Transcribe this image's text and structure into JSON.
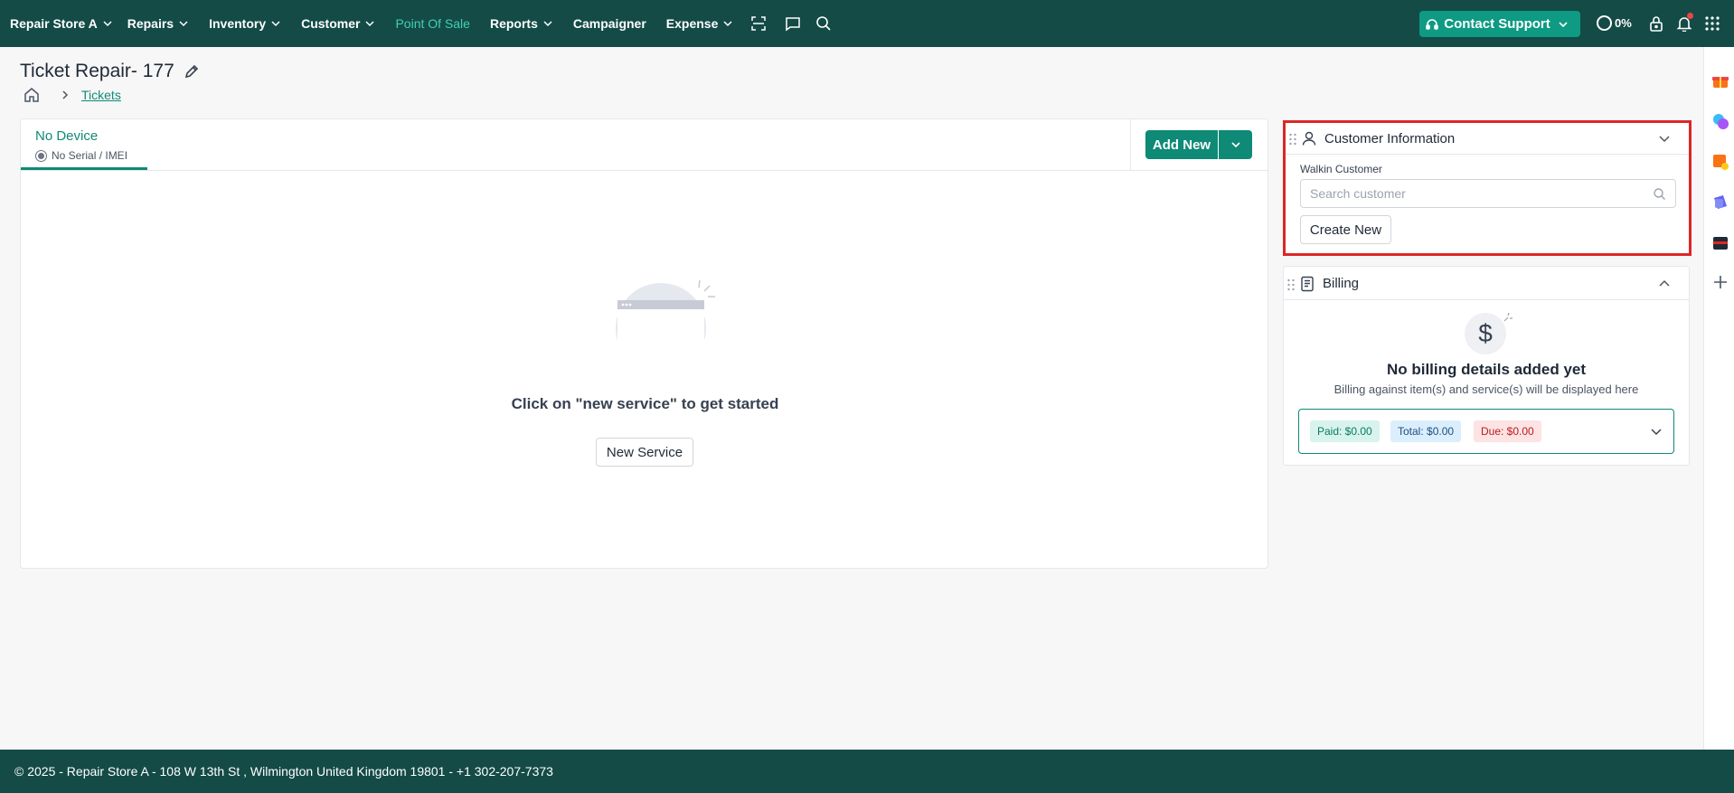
{
  "nav": {
    "store": "Repair Store A",
    "items": [
      {
        "label": "Repairs"
      },
      {
        "label": "Inventory"
      },
      {
        "label": "Customer"
      },
      {
        "label": "Point Of Sale"
      },
      {
        "label": "Reports"
      },
      {
        "label": "Campaigner"
      },
      {
        "label": "Expense"
      }
    ],
    "contact_support": "Contact Support",
    "progress": "0%"
  },
  "page": {
    "title": "Ticket Repair- 177",
    "breadcrumb": "Tickets"
  },
  "device": {
    "title": "No Device",
    "serial": "No Serial / IMEI",
    "add_new": "Add New"
  },
  "empty": {
    "title": "Click on \"new service\" to get started",
    "button": "New Service"
  },
  "customer": {
    "title": "Customer Information",
    "walkin": "Walkin Customer",
    "search_placeholder": "Search customer",
    "create_new": "Create New"
  },
  "billing": {
    "title": "Billing",
    "currency_symbol": "$",
    "empty_title": "No billing details added yet",
    "empty_sub": "Billing against item(s) and service(s) will be displayed here",
    "paid": "Paid: $0.00",
    "total": "Total: $0.00",
    "due": "Due: $0.00"
  },
  "footer": {
    "text": "© 2025 - Repair Store A - 108 W 13th St , Wilmington United Kingdom 19801 - +1 302-207-7373"
  },
  "colors": {
    "nav_bg": "#144b47",
    "accent": "#0e8a76",
    "highlight_border": "#dc2626"
  }
}
